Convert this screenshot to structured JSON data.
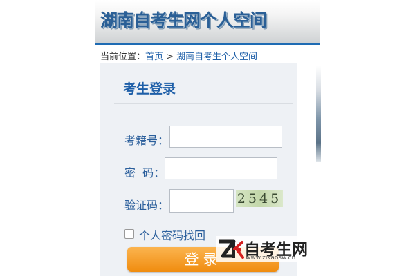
{
  "header": {
    "title": "湖南自考生网个人空间"
  },
  "breadcrumb": {
    "prefix": "当前位置：",
    "home": "首页",
    "separator": ">",
    "current": "湖南自考生个人空间"
  },
  "login": {
    "title": "考生登录",
    "id_label": "考籍号：",
    "id_value": "",
    "password_label": "密  码：",
    "password_value": "",
    "captcha_label": "验证码：",
    "captcha_value": "",
    "captcha_code": "2545",
    "recover_label": "个人密码找回",
    "recover_checked": false,
    "submit_label": "登录"
  },
  "watermark": {
    "name": "自考生网",
    "url": "www.zikaosw.cn"
  },
  "colors": {
    "accent": "#1e5fa8",
    "button": "#f39a1e",
    "panel": "#eef1f5"
  }
}
